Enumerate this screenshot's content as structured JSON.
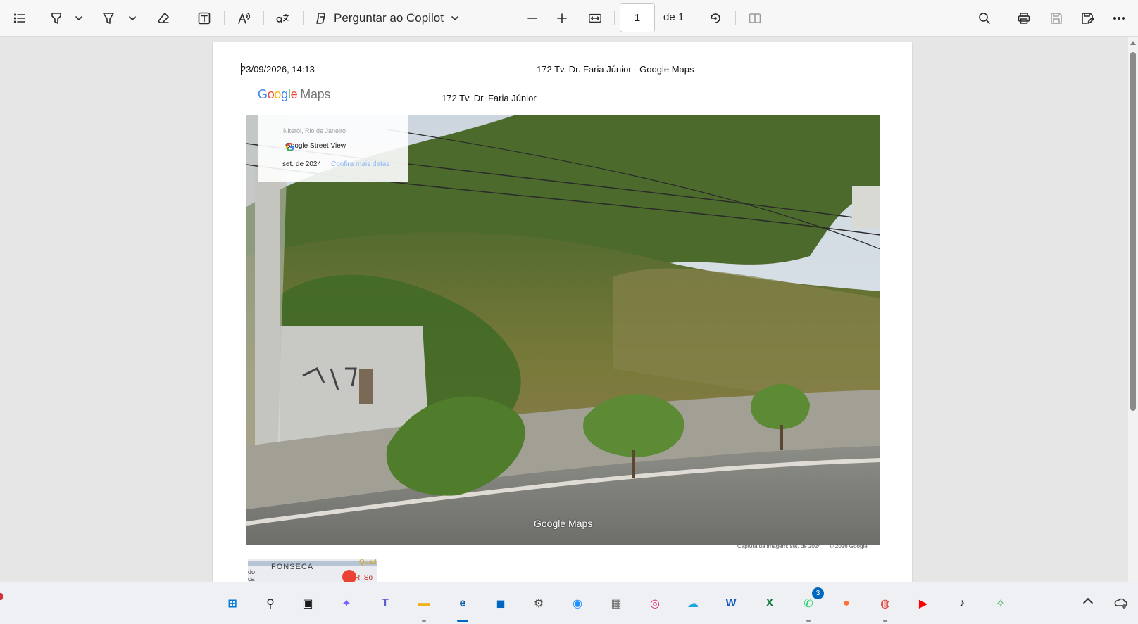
{
  "toolbar": {
    "copilot_label": "Perguntar ao Copilot",
    "page_current": "1",
    "page_of": "de 1",
    "icons": [
      "contents-icon",
      "highlight-icon",
      "draw-icon",
      "erase-icon",
      "text-box-icon",
      "read-aloud-icon",
      "translate-icon",
      "copilot-icon",
      "zoom-out-icon",
      "zoom-in-icon",
      "fit-width-icon",
      "rotate-icon",
      "page-view-icon",
      "search-icon",
      "print-icon",
      "save-icon",
      "save-as-icon",
      "more-icon"
    ]
  },
  "document": {
    "header_datetime": "23/09/2026, 14:13",
    "header_title": "172 Tv. Dr. Faria Júnior - Google Maps",
    "logo": {
      "G": "G",
      "o1": "o",
      "o2": "o",
      "g": "g",
      "l": "l",
      "e": "e",
      "maps": "Maps"
    },
    "address": "172 Tv. Dr. Faria Júnior",
    "streetview": {
      "location": "Niterói, Rio de Janeiro",
      "brand": "Google Street View",
      "date": "set. de 2024",
      "more_dates": "Confira mais datas"
    },
    "watermark": "Google Maps",
    "capture_credit": "Captura da imagem: set. de 2024",
    "copyright": "© 2026 Google",
    "minimap": {
      "label_neighborhood": "FONSECA",
      "label_top_right": "Quad",
      "label_street": "R. So",
      "label_left": "do\nca"
    }
  },
  "taskbar": {
    "apps": [
      {
        "name": "start",
        "glyph": "⊞",
        "color": "#0078d4"
      },
      {
        "name": "search",
        "glyph": "⚲",
        "color": "#1b1b1b"
      },
      {
        "name": "task-view",
        "glyph": "▣",
        "color": "#1b1b1b"
      },
      {
        "name": "copilot",
        "glyph": "✦",
        "color": "#7b61ff"
      },
      {
        "name": "teams",
        "glyph": "T",
        "color": "#5b5fc7"
      },
      {
        "name": "file-explorer",
        "glyph": "▬",
        "color": "#f2b01e"
      },
      {
        "name": "edge",
        "glyph": "e",
        "color": "#0c59a4"
      },
      {
        "name": "store",
        "glyph": "◼",
        "color": "#0067c0"
      },
      {
        "name": "settings",
        "glyph": "⚙",
        "color": "#444"
      },
      {
        "name": "quick-assist",
        "glyph": "◉",
        "color": "#1e90ff"
      },
      {
        "name": "photos",
        "glyph": "▦",
        "color": "#777"
      },
      {
        "name": "instagram",
        "glyph": "◎",
        "color": "#d62976"
      },
      {
        "name": "weather-app",
        "glyph": "☁",
        "color": "#1ca6e0"
      },
      {
        "name": "word",
        "glyph": "W",
        "color": "#185abd"
      },
      {
        "name": "excel",
        "glyph": "X",
        "color": "#107c41"
      },
      {
        "name": "whatsapp",
        "glyph": "✆",
        "color": "#25d366"
      },
      {
        "name": "firefox",
        "glyph": "●",
        "color": "#ff7139"
      },
      {
        "name": "chrome",
        "glyph": "◍",
        "color": "#db4437"
      },
      {
        "name": "youtube",
        "glyph": "▶",
        "color": "#ff0000"
      },
      {
        "name": "tiktok",
        "glyph": "♪",
        "color": "#111"
      },
      {
        "name": "maps-app",
        "glyph": "✧",
        "color": "#34a853"
      }
    ],
    "whatsapp_badge": "3"
  },
  "colors": {
    "accent": "#0067c0",
    "toolbar_bg": "#f7f7f7",
    "doc_bg": "#e6e6e6"
  }
}
